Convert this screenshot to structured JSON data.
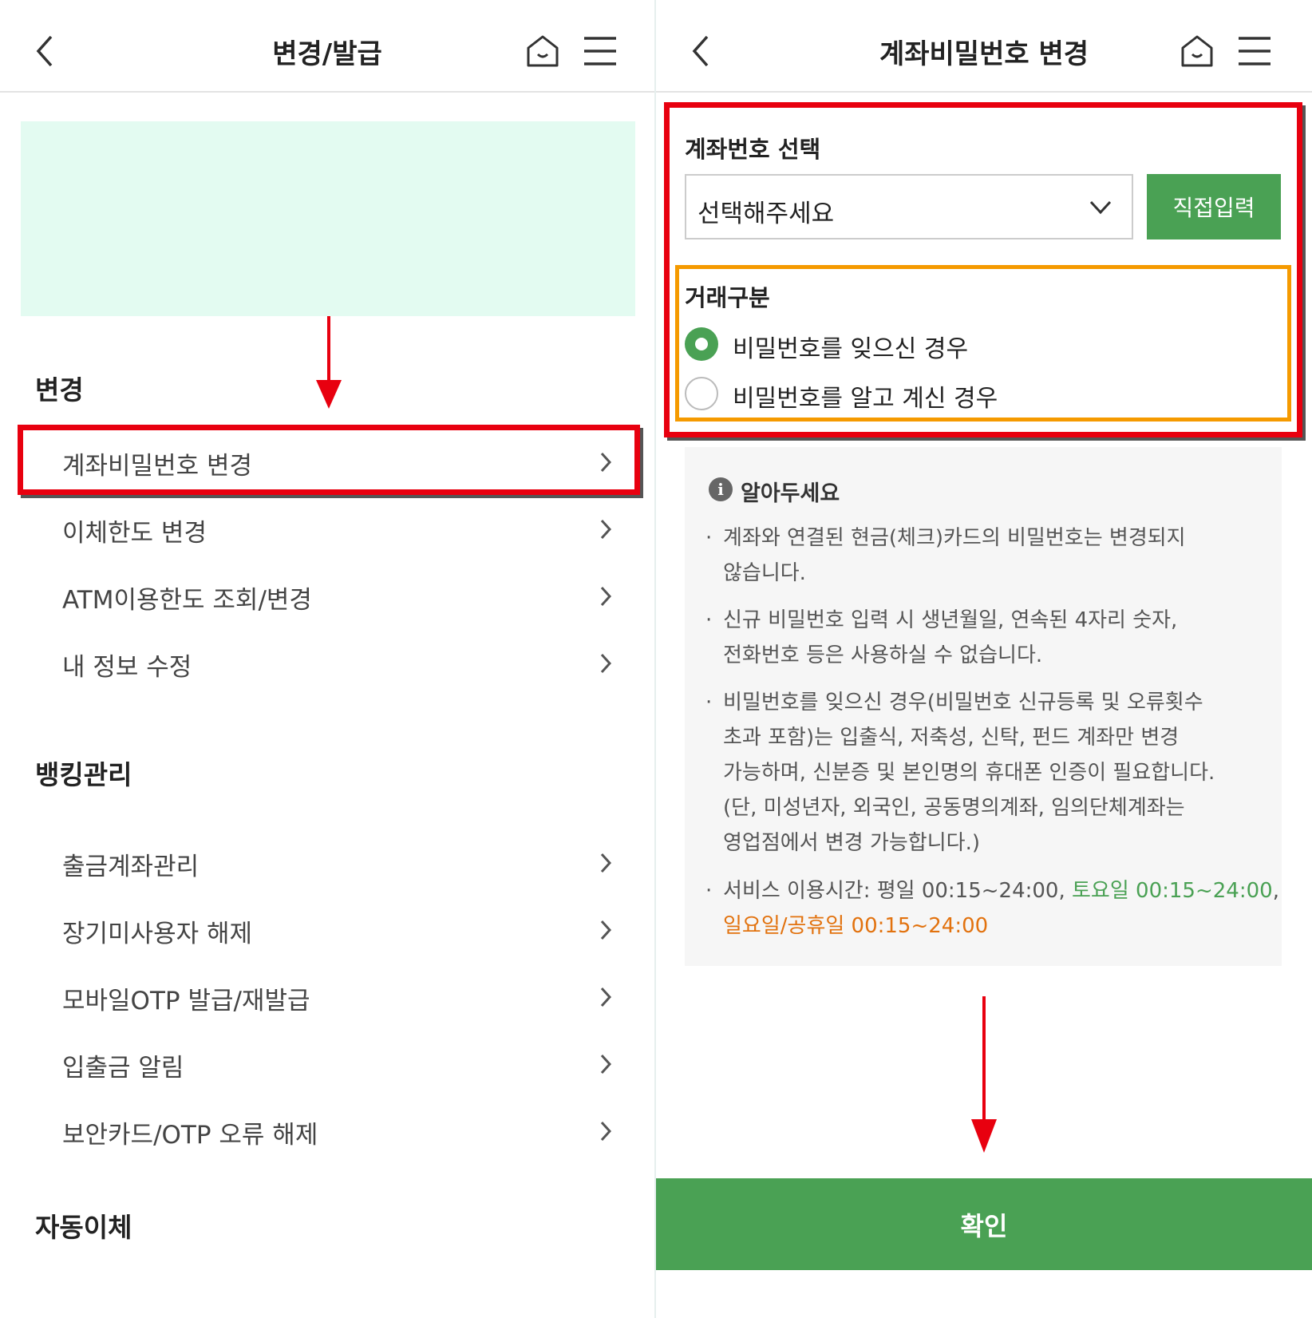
{
  "left": {
    "header": {
      "title": "변경/발급"
    },
    "icons": {
      "back": "chevron-left-icon",
      "home": "home-icon",
      "menu": "hamburger-menu-icon"
    },
    "sections": [
      {
        "title": "변경",
        "items": [
          "계좌비밀번호 변경",
          "이체한도 변경",
          "ATM이용한도 조회/변경",
          "내 정보 수정"
        ]
      },
      {
        "title": "뱅킹관리",
        "items": [
          "출금계좌관리",
          "장기미사용자 해제",
          "모바일OTP 발급/재발급",
          "입출금 알림",
          "보안카드/OTP 오류 해제"
        ]
      },
      {
        "title": "자동이체",
        "items": []
      }
    ]
  },
  "right": {
    "header": {
      "title": "계좌비밀번호 변경"
    },
    "account": {
      "label": "계좌번호 선택",
      "select_value": "선택해주세요",
      "direct_button": "직접입력"
    },
    "transaction": {
      "label": "거래구분",
      "options": [
        {
          "label": "비밀번호를 잊으신 경우",
          "selected": true
        },
        {
          "label": "비밀번호를 알고 계신 경우",
          "selected": false
        }
      ]
    },
    "notice": {
      "title": "알아두세요",
      "bullets": [
        {
          "lines": [
            "계좌와 연결된 현금(체크)카드의 비밀번호는 변경되지",
            "않습니다."
          ]
        },
        {
          "lines": [
            "신규 비밀번호 입력 시 생년월일, 연속된 4자리 숫자,",
            "전화번호 등은 사용하실 수 없습니다."
          ]
        },
        {
          "lines": [
            "비밀번호를 잊으신 경우(비밀번호 신규등록 및 오류횟수",
            "초과 포함)는 입출식, 저축성, 신탁, 펀드 계좌만 변경",
            "가능하며, 신분증 및 본인명의 휴대폰 인증이 필요합니다.",
            "(단, 미성년자, 외국인, 공동명의계좌, 임의단체계좌는",
            "영업점에서 변경 가능합니다.)"
          ]
        }
      ],
      "service_hours": {
        "prefix": "서비스 이용시간: 평일 00:15~24:00, ",
        "saturday": "토요일 00:15~24:00",
        "comma": ",",
        "holiday": "일요일/공휴일 00:15~24:00"
      }
    },
    "confirm_button": "확인"
  },
  "colors": {
    "accent_green": "#4aa154",
    "highlight_red": "#e8000f",
    "highlight_orange": "#f59a00",
    "banner_mint": "#e3fbf1",
    "holiday_orange": "#e2720e"
  }
}
